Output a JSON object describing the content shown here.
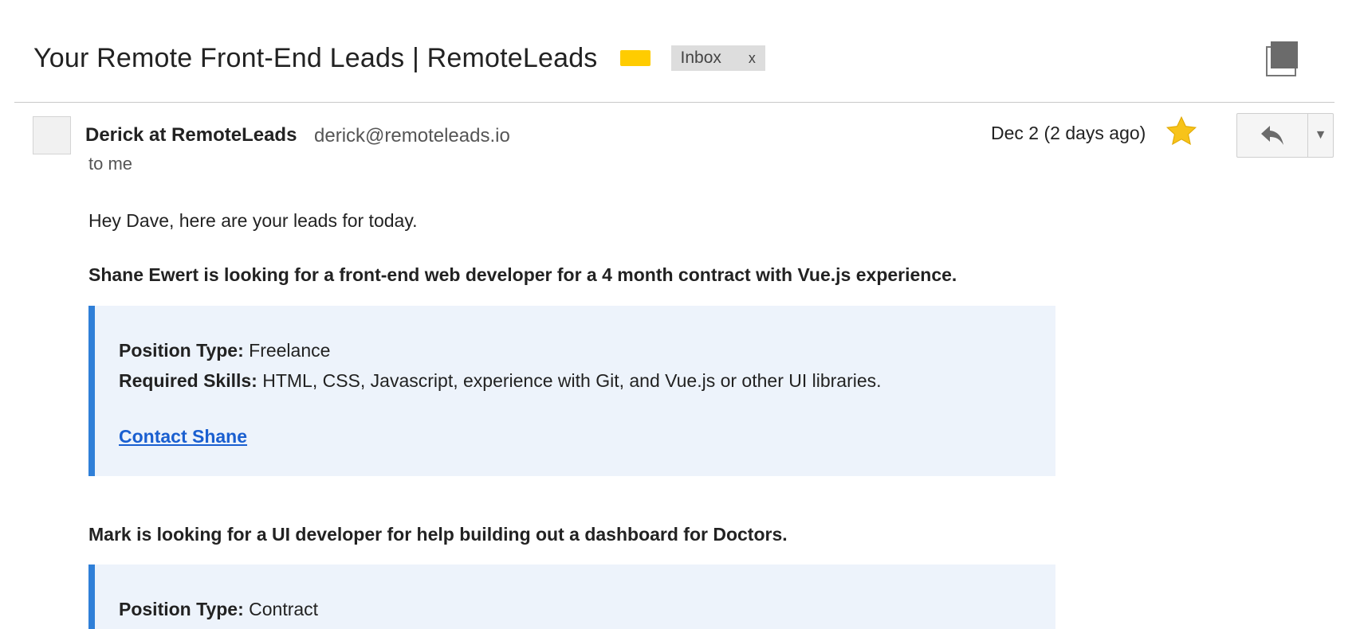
{
  "header": {
    "subject": "Your Remote Front-End Leads | RemoteLeads",
    "label_color": "#ffcc00",
    "inbox_chip": {
      "label": "Inbox",
      "remove": "x"
    },
    "print_icon": "print-all-icon"
  },
  "message": {
    "sender_name": "Derick at RemoteLeads",
    "sender_email": "derick@remoteleads.io",
    "recipient": "to me",
    "date": "Dec 2 (2 days ago)",
    "starred": true,
    "star_color": "#f7c31a",
    "reply_icon": "reply-icon",
    "more_icon": "▼"
  },
  "body": {
    "greeting": "Hey Dave, here are your leads for today.",
    "leads": [
      {
        "headline": "Shane Ewert is looking for a front-end web developer for a 4 month contract with Vue.js experience.",
        "position_type_label": "Position Type:",
        "position_type": "Freelance",
        "skills_label": "Required Skills:",
        "skills": "HTML, CSS, Javascript, experience with Git, and Vue.js or other UI libraries.",
        "contact": "Contact Shane"
      },
      {
        "headline": "Mark is looking for a UI developer for help building out a dashboard for Doctors.",
        "position_type_label": "Position Type:",
        "position_type": "Contract"
      }
    ],
    "accent_color": "#2f7fd8",
    "card_bg": "#edf3fb",
    "link_color": "#1a5fd0"
  }
}
